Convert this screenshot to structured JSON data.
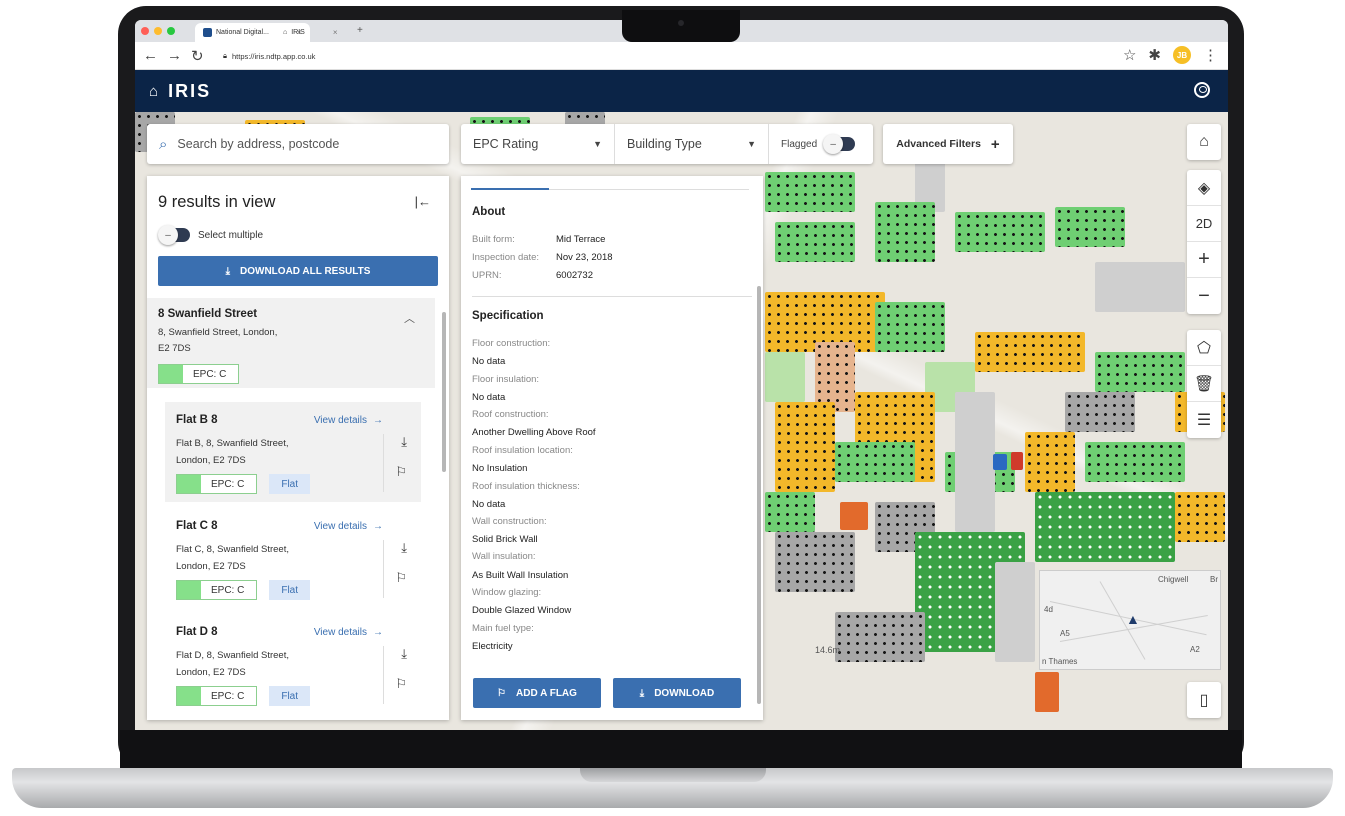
{
  "browser": {
    "tabs": [
      "National Digital...",
      "IRIS"
    ],
    "url": "https://iris.ndtp.app.co.uk",
    "profile_initials": "JB"
  },
  "app": {
    "title": "IRIS"
  },
  "search": {
    "placeholder": "Search by address, postcode"
  },
  "filters": {
    "epc_rating": "EPC Rating",
    "building_type": "Building Type",
    "flagged": "Flagged",
    "advanced": "Advanced Filters"
  },
  "map_controls": {
    "mode_2d": "2D"
  },
  "results": {
    "title": "9 results in view",
    "select_multiple": "Select multiple",
    "download_all": "DOWNLOAD ALL RESULTS",
    "group": {
      "title": "8 Swanfield Street",
      "address_line1": "8, Swanfield Street, London,",
      "address_line2": "E2 7DS",
      "epc": "EPC: C"
    },
    "items": [
      {
        "title": "Flat B 8",
        "view": "View details",
        "line1": "Flat B, 8, Swanfield Street,",
        "line2": "London, E2 7DS",
        "epc": "EPC: C",
        "type": "Flat"
      },
      {
        "title": "Flat C 8",
        "view": "View details",
        "line1": "Flat C, 8, Swanfield Street,",
        "line2": "London, E2 7DS",
        "epc": "EPC: C",
        "type": "Flat"
      },
      {
        "title": "Flat D 8",
        "view": "View details",
        "line1": "Flat D, 8, Swanfield Street,",
        "line2": "London, E2 7DS",
        "epc": "EPC: C",
        "type": "Flat"
      }
    ]
  },
  "detail": {
    "about_title": "About",
    "about": [
      {
        "label": "Built form:",
        "value": "Mid Terrace"
      },
      {
        "label": "Inspection date:",
        "value": "Nov 23, 2018"
      },
      {
        "label": "UPRN:",
        "value": "6002732"
      }
    ],
    "spec_title": "Specification",
    "spec": [
      {
        "label": "Floor construction:",
        "value": "No data"
      },
      {
        "label": "Floor insulation:",
        "value": "No data"
      },
      {
        "label": "Roof construction:",
        "value": "Another Dwelling Above Roof"
      },
      {
        "label": "Roof insulation location:",
        "value": "No Insulation"
      },
      {
        "label": "Roof insulation thickness:",
        "value": "No data"
      },
      {
        "label": "Wall construction:",
        "value": "Solid Brick Wall"
      },
      {
        "label": "Wall insulation:",
        "value": "As Built Wall Insulation"
      },
      {
        "label": "Window glazing:",
        "value": "Double Glazed Window"
      },
      {
        "label": "Main fuel type:",
        "value": "Electricity"
      }
    ],
    "add_flag": "ADD A FLAG",
    "download": "DOWNLOAD"
  },
  "map": {
    "height_label": "14.6m",
    "minimap_labels": [
      "Chigwell",
      "Br",
      "4d",
      "A5",
      "A2",
      "n Thames"
    ]
  },
  "colors": {
    "header_bg": "#0b2447",
    "accent": "#3a6fb0",
    "epc_c": "#86e08a"
  }
}
